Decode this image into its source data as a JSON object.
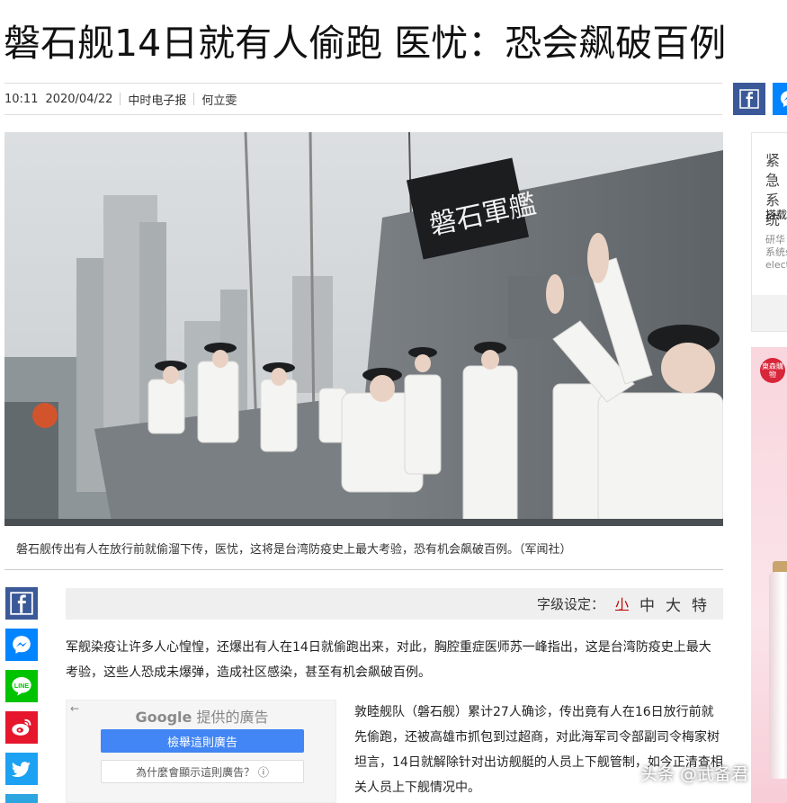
{
  "article": {
    "headline": "磐石舰14日就有人偷跑 医忧：恐会飙破百例",
    "time": "10:11",
    "date": "2020/04/22",
    "source": "中时电子报",
    "author": "何立雯",
    "caption": "磐石舰传出有人在放行前就偷溜下传，医忧，这将是台湾防疫史上最大考验，恐有机会飙破百例。（军闻社）",
    "ship_sign": "磐石軍艦",
    "para1": "军舰染疫让许多人心惶惶，还爆出有人在14日就偷跑出来，对此，胸腔重症医师苏一峰指出，这是台湾防疫史上最大考验，这些人恐成未爆弹，造成社区感染，甚至有机会飙破百例。",
    "para2": "敦睦舰队（磐石舰）累计27人确诊，传出竟有人在16日放行前就先偷跑，还被高雄市抓包到过超商，对此海军司令部副司令梅家树坦言，14日就解除针对出访舰艇的人员上下舰管制，如今正清查相关人员上下舰情况中。"
  },
  "font_setting": {
    "label": "字级设定：",
    "options": [
      "小",
      "中",
      "大",
      "特"
    ],
    "selected": "小"
  },
  "ad": {
    "back": "←",
    "provider": "Google",
    "provided_text": "提供的廣告",
    "report_button": "檢舉這則廣告",
    "why_button": "為什麼會顯示這則廣告？ ⓘ"
  },
  "sidebar": {
    "title": "紧急系统",
    "subtitle": "搭载",
    "desc": "研华系统select"
  },
  "right_ad": {
    "badge": "東森購物"
  },
  "watermark": "头条 @武备君",
  "share_icons": [
    "facebook-icon",
    "messenger-icon",
    "line-icon",
    "weibo-icon",
    "twitter-icon",
    "telegram-icon"
  ],
  "colors": {
    "facebook": "#3b5998",
    "messenger": "#0084ff",
    "line": "#00c300",
    "weibo": "#e6162d",
    "twitter": "#1da1f2",
    "active_font": "#c00000"
  }
}
